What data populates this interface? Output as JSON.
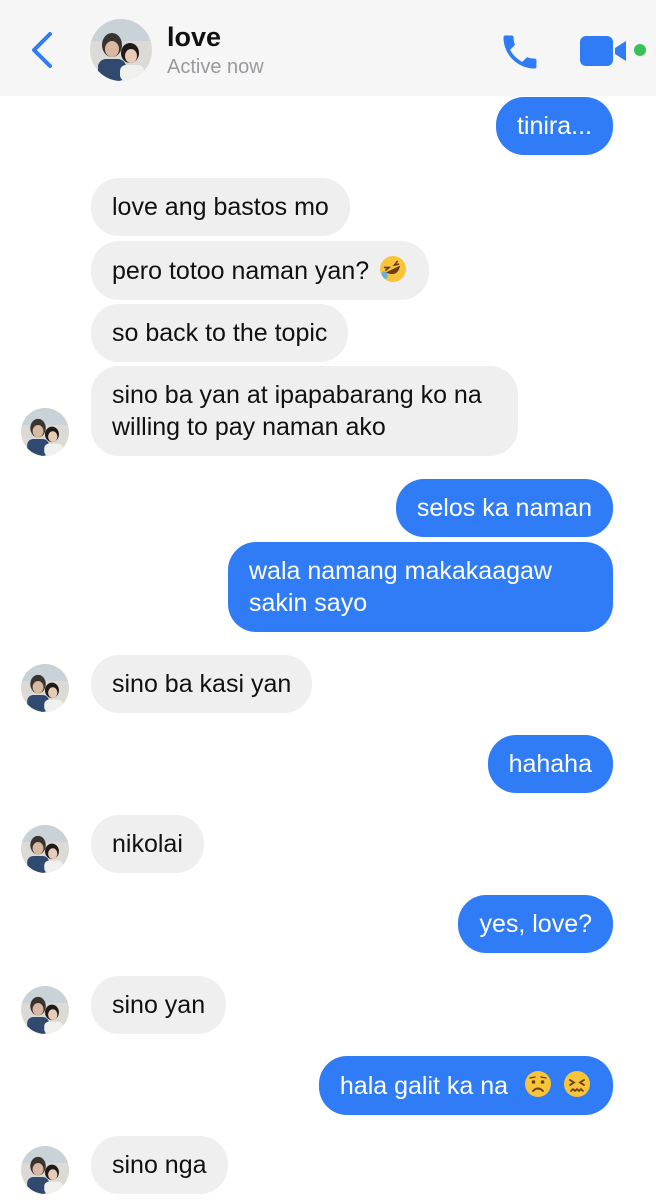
{
  "header": {
    "name": "love",
    "status": "Active now",
    "icons": {
      "back": "chevron-left-icon",
      "call": "phone-icon",
      "video": "video-camera-icon"
    },
    "online_color": "#35c25a"
  },
  "colors": {
    "outgoing": "#2f7cf6",
    "incoming": "#efeff0",
    "accent": "#2f7cf6"
  },
  "messages": [
    {
      "side": "out",
      "text": "tinira..."
    },
    {
      "side": "in",
      "text": "love ang bastos mo"
    },
    {
      "side": "in",
      "text": "pero totoo naman yan?",
      "emoji": "rolling-on-floor-laughing"
    },
    {
      "side": "in",
      "text": "so back to the topic"
    },
    {
      "side": "in",
      "text": "sino ba yan at ipapabarang ko na willing to pay naman ako"
    },
    {
      "side": "out",
      "text": "selos ka naman"
    },
    {
      "side": "out",
      "text": "wala namang makakaagaw sakin sayo"
    },
    {
      "side": "in",
      "text": "sino ba kasi yan"
    },
    {
      "side": "out",
      "text": "hahaha"
    },
    {
      "side": "in",
      "text": "nikolai"
    },
    {
      "side": "out",
      "text": "yes, love?"
    },
    {
      "side": "in",
      "text": "sino yan"
    },
    {
      "side": "out",
      "text": "hala galit ka na",
      "emoji": [
        "worried-face",
        "persevering-face"
      ]
    },
    {
      "side": "in",
      "text": "sino nga"
    }
  ]
}
